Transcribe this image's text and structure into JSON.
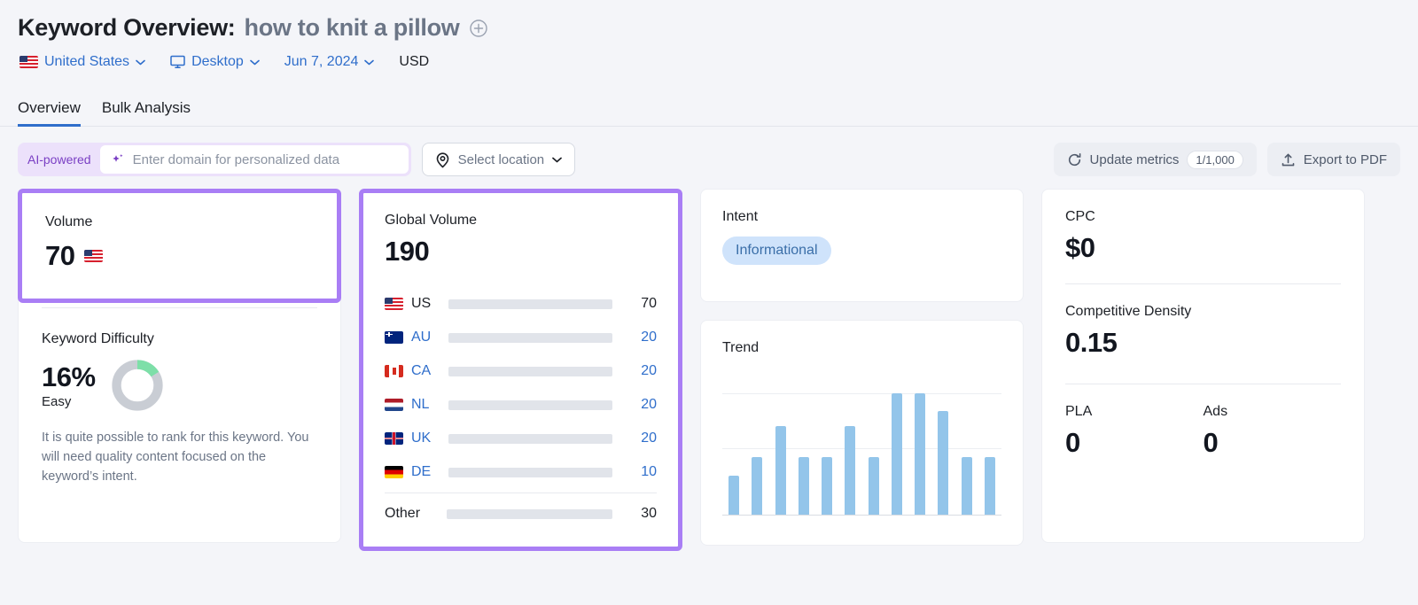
{
  "header": {
    "title_prefix": "Keyword Overview:",
    "keyword": "how to knit a pillow",
    "add_icon": "plus-circle-icon",
    "country": "United States",
    "device": "Desktop",
    "date": "Jun 7, 2024",
    "currency": "USD"
  },
  "tabs": [
    {
      "label": "Overview",
      "active": true
    },
    {
      "label": "Bulk Analysis",
      "active": false
    }
  ],
  "toolbar": {
    "ai_badge": "AI-powered",
    "domain_placeholder": "Enter domain for personalized data",
    "location_label": "Select location",
    "update_metrics_label": "Update metrics",
    "update_metrics_count": "1/1,000",
    "export_label": "Export to PDF"
  },
  "volume_card": {
    "label": "Volume",
    "value": "70",
    "flag": "us",
    "highlighted": true
  },
  "keyword_difficulty": {
    "label": "Keyword Difficulty",
    "value": "16%",
    "percent": 16,
    "rating": "Easy",
    "description": "It is quite possible to rank for this keyword. You will need quality content focused on the keyword’s intent.",
    "arc_color": "#7ddfa8",
    "track_color": "#c9cdd4"
  },
  "global_volume": {
    "label": "Global Volume",
    "value": "190",
    "total": 190,
    "highlighted": true,
    "rows": [
      {
        "code": "US",
        "flag": "us",
        "value": "70",
        "amount": 70,
        "primary": true
      },
      {
        "code": "AU",
        "flag": "au",
        "value": "20",
        "amount": 20,
        "primary": false
      },
      {
        "code": "CA",
        "flag": "ca",
        "value": "20",
        "amount": 20,
        "primary": false
      },
      {
        "code": "NL",
        "flag": "nl",
        "value": "20",
        "amount": 20,
        "primary": false
      },
      {
        "code": "UK",
        "flag": "uk",
        "value": "20",
        "amount": 20,
        "primary": false
      },
      {
        "code": "DE",
        "flag": "de",
        "value": "10",
        "amount": 10,
        "primary": false
      }
    ],
    "other": {
      "code": "Other",
      "value": "30",
      "amount": 30
    }
  },
  "intent_card": {
    "label": "Intent",
    "chip": "Informational"
  },
  "trend_card": {
    "label": "Trend"
  },
  "cpc_card": {
    "cpc_label": "CPC",
    "cpc_value": "$0",
    "density_label": "Competitive Density",
    "density_value": "0.15",
    "pla_label": "PLA",
    "pla_value": "0",
    "ads_label": "Ads",
    "ads_value": "0"
  },
  "colors": {
    "accent_blue": "#2f6ecb",
    "highlight_purple": "#a97ef5",
    "bar_blue": "#93c5ea",
    "bar_primary": "#2b74c8",
    "bar_secondary": "#62b0ef",
    "track_gray": "#e1e4ea",
    "page_bg": "#f4f5f9"
  },
  "chart_data": {
    "type": "bar",
    "title": "Trend",
    "categories": [
      "1",
      "2",
      "3",
      "4",
      "5",
      "6",
      "7",
      "8",
      "9",
      "10",
      "11",
      "12"
    ],
    "values": [
      32,
      47,
      73,
      47,
      47,
      73,
      47,
      100,
      100,
      85,
      47,
      47
    ],
    "xlabel": "",
    "ylabel": "",
    "ylim": [
      0,
      110
    ],
    "grid": true,
    "gridlines": [
      55,
      100
    ],
    "legend": "none"
  }
}
